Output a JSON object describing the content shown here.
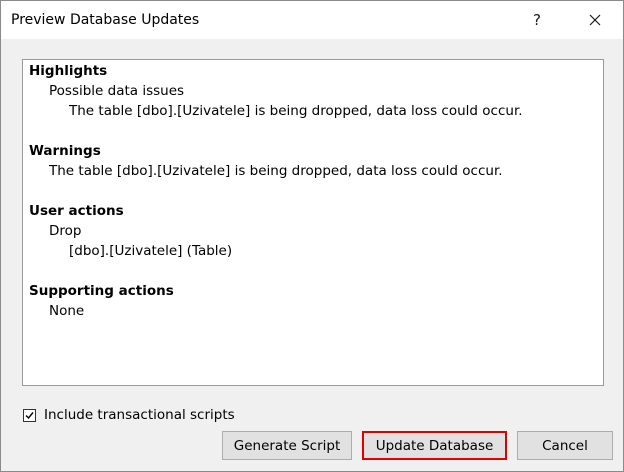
{
  "window": {
    "title": "Preview Database Updates",
    "help_glyph": "?",
    "close_icon": "close-icon"
  },
  "report": {
    "highlights_heading": "Highlights",
    "highlights_subheading": "Possible data issues",
    "highlights_detail": "The table [dbo].[Uzivatele] is being dropped, data loss could occur.",
    "warnings_heading": "Warnings",
    "warnings_detail": "The table [dbo].[Uzivatele] is being dropped, data loss could occur.",
    "user_actions_heading": "User actions",
    "user_actions_action": "Drop",
    "user_actions_object": "[dbo].[Uzivatele] (Table)",
    "supporting_heading": "Supporting actions",
    "supporting_detail": "None"
  },
  "options": {
    "include_transactional_label": "Include transactional scripts",
    "include_transactional_checked": true
  },
  "buttons": {
    "generate_script": "Generate Script",
    "update_database": "Update Database",
    "cancel": "Cancel"
  },
  "colors": {
    "focus_border": "#e00000",
    "button_face": "#e1e1e1",
    "dialog_background": "#f0f0f0"
  }
}
